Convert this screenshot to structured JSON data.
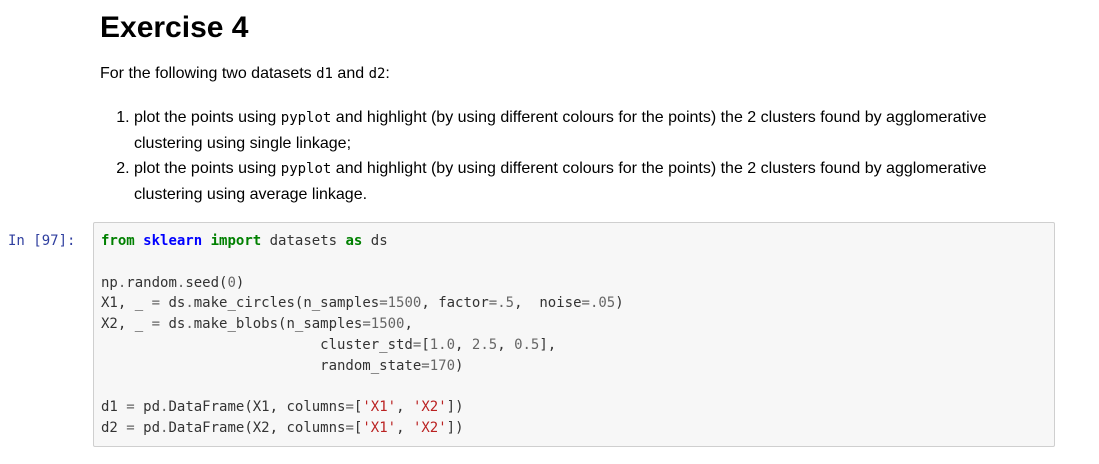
{
  "markdown": {
    "title": "Exercise 4",
    "intro": {
      "before": "For the following two datasets ",
      "code1": "d1",
      "middle": " and ",
      "code2": "d2",
      "after": ":"
    },
    "list": [
      {
        "before": "plot the points using ",
        "code": "pyplot",
        "after": " and highlight (by using different colours for the points) the 2 clusters found by agglomerative clustering using single linkage;"
      },
      {
        "before": "plot the points using ",
        "code": "pyplot",
        "after": " and highlight (by using different colours for the points) the 2 clusters found by agglomerative clustering using average linkage."
      }
    ]
  },
  "code_cell": {
    "prompt": "In [97]:",
    "tokens": [
      [
        "kw",
        "from"
      ],
      [
        "t",
        " "
      ],
      [
        "ns",
        "sklearn"
      ],
      [
        "t",
        " "
      ],
      [
        "kw",
        "import"
      ],
      [
        "t",
        " datasets "
      ],
      [
        "kw",
        "as"
      ],
      [
        "t",
        " ds\n\nnp"
      ],
      [
        "op",
        "."
      ],
      [
        "t",
        "random"
      ],
      [
        "op",
        "."
      ],
      [
        "t",
        "seed("
      ],
      [
        "num",
        "0"
      ],
      [
        "t",
        ")\nX1, _ "
      ],
      [
        "op",
        "="
      ],
      [
        "t",
        " ds"
      ],
      [
        "op",
        "."
      ],
      [
        "t",
        "make_circles(n_samples"
      ],
      [
        "op",
        "="
      ],
      [
        "num",
        "1500"
      ],
      [
        "t",
        ", factor"
      ],
      [
        "op",
        "="
      ],
      [
        "num",
        ".5"
      ],
      [
        "t",
        ",  noise"
      ],
      [
        "op",
        "="
      ],
      [
        "num",
        ".05"
      ],
      [
        "t",
        ")\nX2, _ "
      ],
      [
        "op",
        "="
      ],
      [
        "t",
        " ds"
      ],
      [
        "op",
        "."
      ],
      [
        "t",
        "make_blobs(n_samples"
      ],
      [
        "op",
        "="
      ],
      [
        "num",
        "1500"
      ],
      [
        "t",
        ",\n                          cluster_std"
      ],
      [
        "op",
        "="
      ],
      [
        "t",
        "["
      ],
      [
        "num",
        "1.0"
      ],
      [
        "t",
        ", "
      ],
      [
        "num",
        "2.5"
      ],
      [
        "t",
        ", "
      ],
      [
        "num",
        "0.5"
      ],
      [
        "t",
        "],\n                          random_state"
      ],
      [
        "op",
        "="
      ],
      [
        "num",
        "170"
      ],
      [
        "t",
        ")\n\nd1 "
      ],
      [
        "op",
        "="
      ],
      [
        "t",
        " pd"
      ],
      [
        "op",
        "."
      ],
      [
        "t",
        "DataFrame(X1, columns"
      ],
      [
        "op",
        "="
      ],
      [
        "t",
        "["
      ],
      [
        "str",
        "'X1'"
      ],
      [
        "t",
        ", "
      ],
      [
        "str",
        "'X2'"
      ],
      [
        "t",
        "])\nd2 "
      ],
      [
        "op",
        "="
      ],
      [
        "t",
        " pd"
      ],
      [
        "op",
        "."
      ],
      [
        "t",
        "DataFrame(X2, columns"
      ],
      [
        "op",
        "="
      ],
      [
        "t",
        "["
      ],
      [
        "str",
        "'X1'"
      ],
      [
        "t",
        ", "
      ],
      [
        "str",
        "'X2'"
      ],
      [
        "t",
        "])"
      ]
    ]
  }
}
